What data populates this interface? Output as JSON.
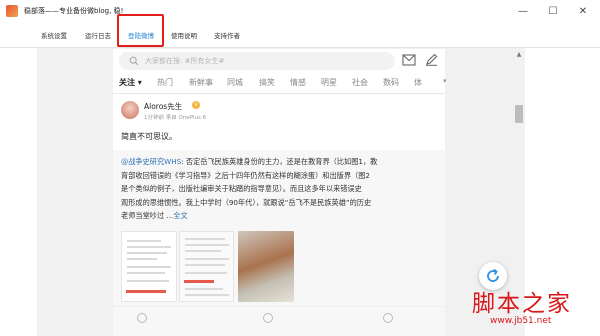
{
  "window": {
    "title": "稳部落——专业备份微blog, 稳!"
  },
  "tabs": [
    {
      "label": "系统设置",
      "active": false
    },
    {
      "label": "运行日志",
      "active": false
    },
    {
      "label": "登陆微博",
      "active": true
    },
    {
      "label": "使用说明",
      "active": false
    },
    {
      "label": "支持作者",
      "active": false
    }
  ],
  "weibo": {
    "search_placeholder": "大家都在搜: #所有女生#",
    "categories": [
      "关注",
      "热门",
      "新鲜事",
      "同城",
      "搞笑",
      "情感",
      "明星",
      "社会",
      "数码",
      "体"
    ],
    "post": {
      "author": "Aloros先生",
      "badge": "V",
      "meta": "1分钟前 来自 OnePlus 6",
      "text": "简直不可思议。",
      "quote_lines": [
        {
          "link": "@战争史研究WHS",
          "text": ": 否定岳飞民族英雄身份的主力，还是在教育界（比如图1，教"
        },
        {
          "link": "",
          "text": "育部收回错误的《学习指导》之后十四年仍然有这样的糊涂蛋）和出版界（图2"
        },
        {
          "link": "",
          "text": "是个类似的例子，出版社编审关于粘踏的指导意见）。而且这多年以来错误史"
        },
        {
          "link": "",
          "text": "观形成的思维惯性。我上中学时（90年代），就跟说“岳飞不是民族英雄”的历史"
        },
        {
          "link": "全文",
          "text": "老师当堂吵过 ..."
        }
      ]
    }
  },
  "watermark": {
    "main": "脚本之家",
    "url": "www.jb51.net"
  },
  "colors": {
    "accent": "#1e7fd6",
    "highlight": "#e2201b",
    "link": "#2d73b3",
    "watermark": "#d8181b"
  }
}
